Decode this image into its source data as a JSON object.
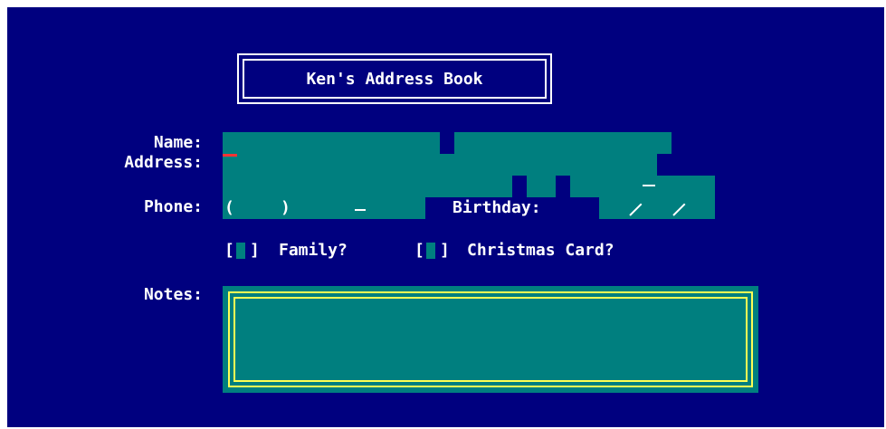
{
  "window": {
    "title": "Ken's Address Book"
  },
  "form": {
    "name_label": "Name:",
    "address_label": "Address:",
    "phone_label": "Phone:",
    "phone_open_paren": "(",
    "phone_close_paren": ")",
    "phone_dash": "-",
    "birthday_label": "Birthday:",
    "birthday_sep": "/",
    "notes_label": "Notes:",
    "name_value": "",
    "address_value": "",
    "phone_value": "",
    "birthday_value": ""
  },
  "options": {
    "family_bracket_open": "[",
    "family_bracket_close": "]",
    "family_label": "Family?",
    "family_checked": false,
    "xmas_bracket_open": "[",
    "xmas_bracket_close": "]",
    "xmas_label": "Christmas Card?",
    "xmas_checked": false
  },
  "colors": {
    "background": "#00007f",
    "field": "#007f7f",
    "text": "#ffffff",
    "notes_border": "#ffff55",
    "cursor": "#ff3333"
  }
}
